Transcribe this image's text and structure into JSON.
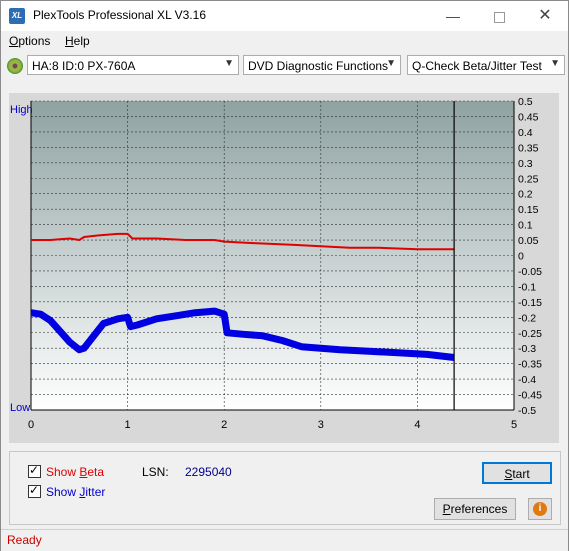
{
  "window": {
    "title": "PlexTools Professional XL V3.16",
    "app_icon": "XL"
  },
  "menu": [
    {
      "label": "Options",
      "key": "O",
      "rest": "ptions"
    },
    {
      "label": "Help",
      "key": "H",
      "rest": "elp"
    }
  ],
  "toolbar": {
    "drive": "HA:8 ID:0  PX-760A",
    "function": "DVD Diagnostic Functions",
    "test": "Q-Check Beta/Jitter Test"
  },
  "chart_data": {
    "type": "line",
    "y_left_labels": {
      "top": "High",
      "bottom": "Low"
    },
    "yticks": [
      "0.5",
      "0.45",
      "0.4",
      "0.35",
      "0.3",
      "0.25",
      "0.2",
      "0.15",
      "0.1",
      "0.05",
      "0",
      "-0.05",
      "-0.1",
      "-0.15",
      "-0.2",
      "-0.25",
      "-0.3",
      "-0.35",
      "-0.4",
      "-0.45",
      "-0.5"
    ],
    "xticks": [
      "0",
      "1",
      "2",
      "3",
      "4",
      "5"
    ],
    "xlim": [
      0,
      5
    ],
    "ylim": [
      -0.5,
      0.5
    ],
    "cursor_x": 4.38,
    "series": [
      {
        "name": "Beta",
        "color": "#e00000",
        "x": [
          0,
          0.2,
          0.4,
          0.5,
          0.55,
          0.7,
          0.9,
          1.0,
          1.05,
          1.3,
          1.6,
          1.9,
          2.0,
          2.3,
          2.7,
          3.0,
          3.3,
          3.6,
          4.0,
          4.38
        ],
        "y": [
          0.05,
          0.05,
          0.055,
          0.05,
          0.06,
          0.065,
          0.07,
          0.07,
          0.055,
          0.055,
          0.05,
          0.05,
          0.045,
          0.04,
          0.035,
          0.03,
          0.025,
          0.025,
          0.02,
          0.02
        ]
      },
      {
        "name": "Jitter",
        "color": "#0000e0",
        "x": [
          0,
          0.1,
          0.2,
          0.3,
          0.4,
          0.5,
          0.55,
          0.65,
          0.75,
          0.9,
          1.0,
          1.03,
          1.1,
          1.3,
          1.5,
          1.7,
          1.9,
          2.0,
          2.03,
          2.2,
          2.4,
          2.6,
          2.8,
          3.0,
          3.2,
          3.5,
          3.8,
          4.1,
          4.38
        ],
        "y": [
          -0.185,
          -0.19,
          -0.21,
          -0.245,
          -0.28,
          -0.305,
          -0.3,
          -0.26,
          -0.22,
          -0.205,
          -0.2,
          -0.23,
          -0.225,
          -0.205,
          -0.195,
          -0.185,
          -0.18,
          -0.19,
          -0.25,
          -0.255,
          -0.26,
          -0.275,
          -0.295,
          -0.3,
          -0.305,
          -0.31,
          -0.315,
          -0.32,
          -0.33
        ]
      }
    ]
  },
  "bottom": {
    "show_beta": {
      "label": "Show Beta",
      "key": "B",
      "pre": "Show ",
      "post": "eta",
      "checked": true,
      "color": "#e00000"
    },
    "show_jitter": {
      "label": "Show Jitter",
      "key": "J",
      "pre": "Show ",
      "post": "itter",
      "checked": true,
      "color": "#0000cc"
    },
    "lsn_label": "LSN:",
    "lsn_value": "2295040",
    "start": {
      "label": "Start",
      "key": "S",
      "rest": "tart"
    },
    "preferences": {
      "label": "Preferences",
      "key": "P",
      "rest": "references"
    },
    "info_icon": "info-icon"
  },
  "status": {
    "text": "Ready",
    "color": "#cc0000"
  }
}
